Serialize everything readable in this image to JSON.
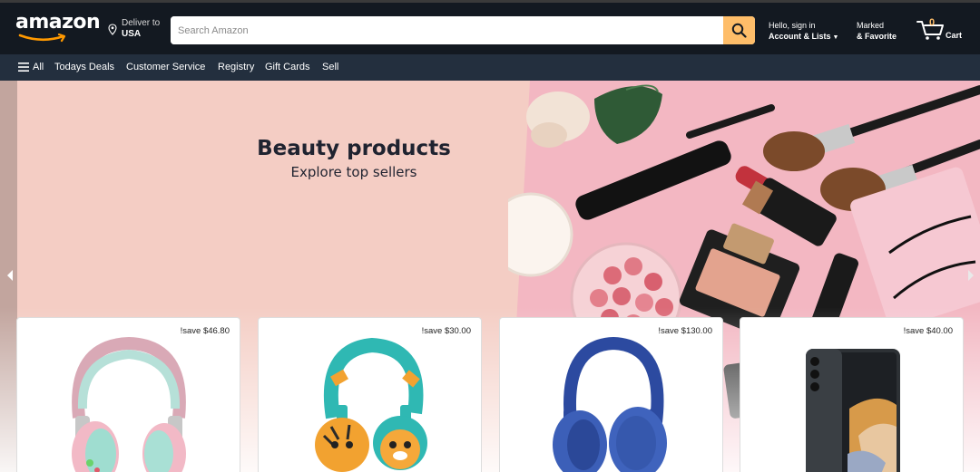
{
  "header": {
    "logo_text": "amazon",
    "deliver_label": "Deliver to",
    "deliver_location": "USA",
    "search_placeholder": "Search Amazon",
    "account_greeting": "Hello, sign in",
    "account_lists": "Account & Lists",
    "marked_label": "Marked",
    "favorite_label": "& Favorite",
    "cart_count": "0",
    "cart_label": "Cart"
  },
  "nav": {
    "all_label": "All",
    "items": [
      "Todays Deals",
      "Customer Service",
      "Registry",
      "Gift Cards",
      "Sell"
    ]
  },
  "hero": {
    "title": "Beauty products",
    "subtitle": "Explore top sellers"
  },
  "products": [
    {
      "save": "!save $46.80",
      "image": "pink-mint-headphones"
    },
    {
      "save": "!save $30.00",
      "image": "kids-tiger-headphones"
    },
    {
      "save": "!save $130.00",
      "image": "blue-jbl-headphones"
    },
    {
      "save": "!save $40.00",
      "image": "foldable-phone"
    }
  ],
  "icons": {
    "location": "location-pin-icon",
    "search": "search-icon",
    "cart": "cart-icon",
    "menu": "hamburger-menu-icon",
    "prev": "chevron-left-icon",
    "next": "chevron-right-icon"
  },
  "colors": {
    "header_bg": "#131921",
    "nav_bg": "#232f3e",
    "accent": "#febd69",
    "hero_bg": "#f4cdc4"
  }
}
